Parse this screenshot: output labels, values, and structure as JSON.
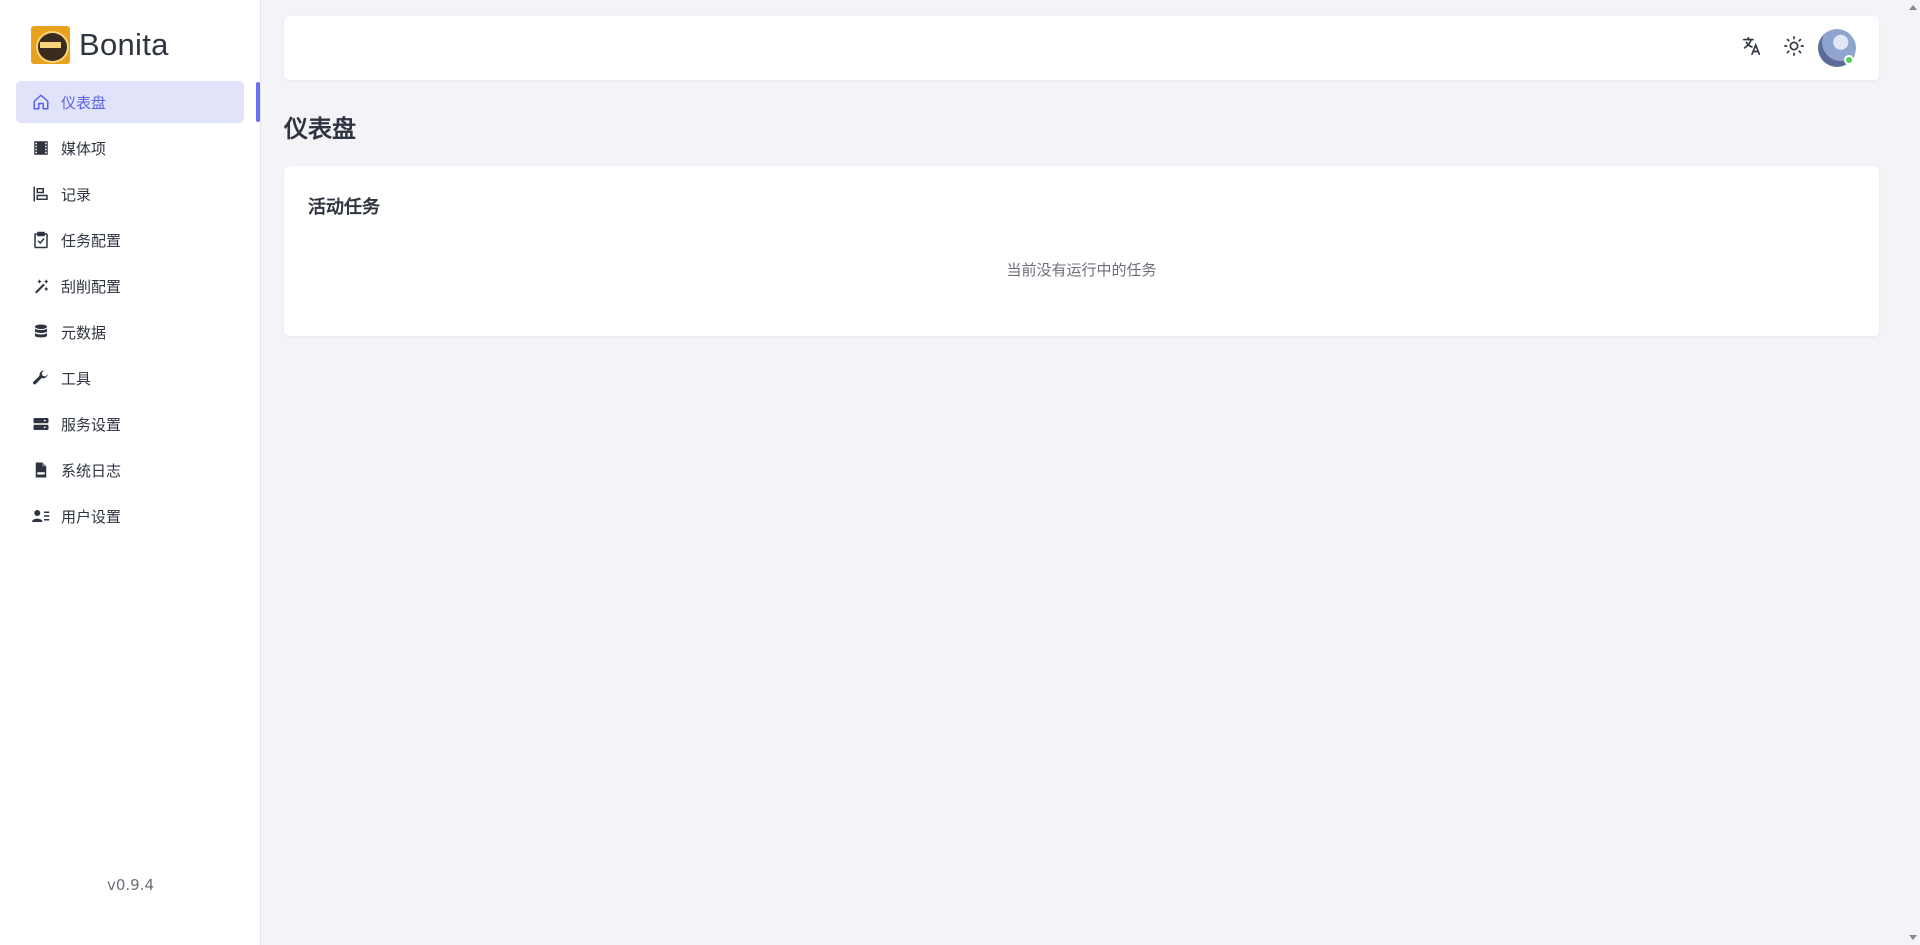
{
  "app": {
    "name": "Bonita",
    "version": "v0.9.4"
  },
  "sidebar": {
    "items": [
      {
        "label": "仪表盘",
        "icon": "home-icon",
        "active": true
      },
      {
        "label": "媒体项",
        "icon": "film-icon",
        "active": false
      },
      {
        "label": "记录",
        "icon": "align-left-chart-icon",
        "active": false
      },
      {
        "label": "任务配置",
        "icon": "clipboard-check-icon",
        "active": false
      },
      {
        "label": "刮削配置",
        "icon": "magic-wand-icon",
        "active": false
      },
      {
        "label": "元数据",
        "icon": "database-icon",
        "active": false
      },
      {
        "label": "工具",
        "icon": "wrench-icon",
        "active": false
      },
      {
        "label": "服务设置",
        "icon": "server-icon",
        "active": false
      },
      {
        "label": "系统日志",
        "icon": "document-icon",
        "active": false
      },
      {
        "label": "用户设置",
        "icon": "user-list-icon",
        "active": false
      }
    ]
  },
  "header": {
    "translate_icon": "translate-icon",
    "theme_icon": "sun-icon",
    "avatar_status": "online"
  },
  "main": {
    "page_title": "仪表盘",
    "active_tasks": {
      "title": "活动任务",
      "empty_text": "当前没有运行中的任务"
    }
  },
  "colors": {
    "accent": "#5b62e8",
    "active_bg": "#e1e3fb",
    "background": "#f3f3f8",
    "online": "#4cd15f"
  }
}
